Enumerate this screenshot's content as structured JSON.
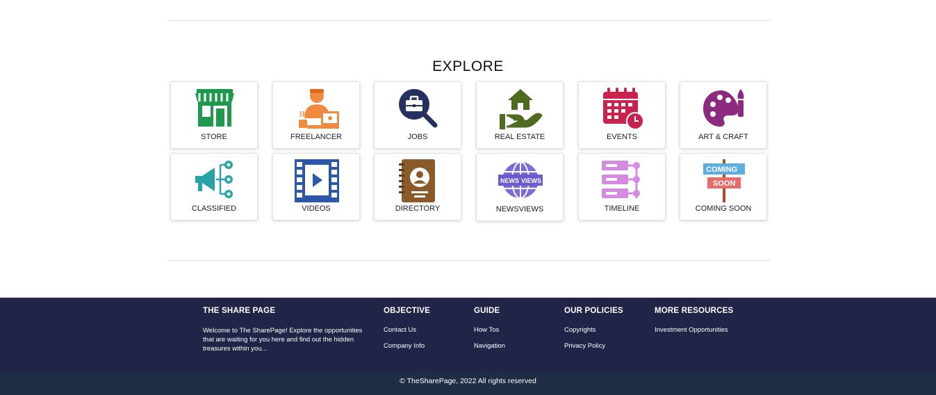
{
  "explore": {
    "title": "EXPLORE",
    "tiles": [
      {
        "label": "STORE",
        "icon": "store-icon",
        "color": "#1f9a4c"
      },
      {
        "label": "FREELANCER",
        "icon": "freelancer-icon",
        "color": "#f08a3e"
      },
      {
        "label": "JOBS",
        "icon": "jobs-icon",
        "color": "#24305e"
      },
      {
        "label": "REAL ESTATE",
        "icon": "real-estate-icon",
        "color": "#4e6b20"
      },
      {
        "label": "EVENTS",
        "icon": "events-icon",
        "color": "#c8234d"
      },
      {
        "label": "ART & CRAFT",
        "icon": "art-craft-icon",
        "color": "#8b2a7f"
      },
      {
        "label": "CLASSIFIED",
        "icon": "classified-icon",
        "color": "#2aa3a8"
      },
      {
        "label": "VIDEOS",
        "icon": "videos-icon",
        "color": "#2d57a8"
      },
      {
        "label": "DIRECTORY",
        "icon": "directory-icon",
        "color": "#8b5a2b"
      },
      {
        "label": "NEWSVIEWS",
        "icon": "newsviews-icon",
        "color": "#6a5acd"
      },
      {
        "label": "TIMELINE",
        "icon": "timeline-icon",
        "color": "#d58ce0"
      },
      {
        "label": "COMING SOON",
        "icon": "coming-soon-icon",
        "color": "#e86a6a"
      }
    ]
  },
  "footer": {
    "about": {
      "heading": "THE SHARE PAGE",
      "text": "Welcome to The SharePage! Explore the opportunities that are waiting for you here and find out the hidden treasures within you..."
    },
    "objective": {
      "heading": "OBJECTIVE",
      "links": [
        "Contact Us",
        "Company Info"
      ]
    },
    "guide": {
      "heading": "GUIDE",
      "links": [
        "How Tos",
        "Navigation"
      ]
    },
    "policies": {
      "heading": "OUR POLICIES",
      "links": [
        "Copyrights",
        "Privacy Policy"
      ]
    },
    "resources": {
      "heading": "MORE RESOURCES",
      "links": [
        "Investment Opportunities"
      ]
    },
    "copyright": "© TheSharePage, 2022 All rights reserved"
  },
  "colors": {
    "footer_bg": "#212447",
    "copyright_bg": "#1e2d45"
  }
}
